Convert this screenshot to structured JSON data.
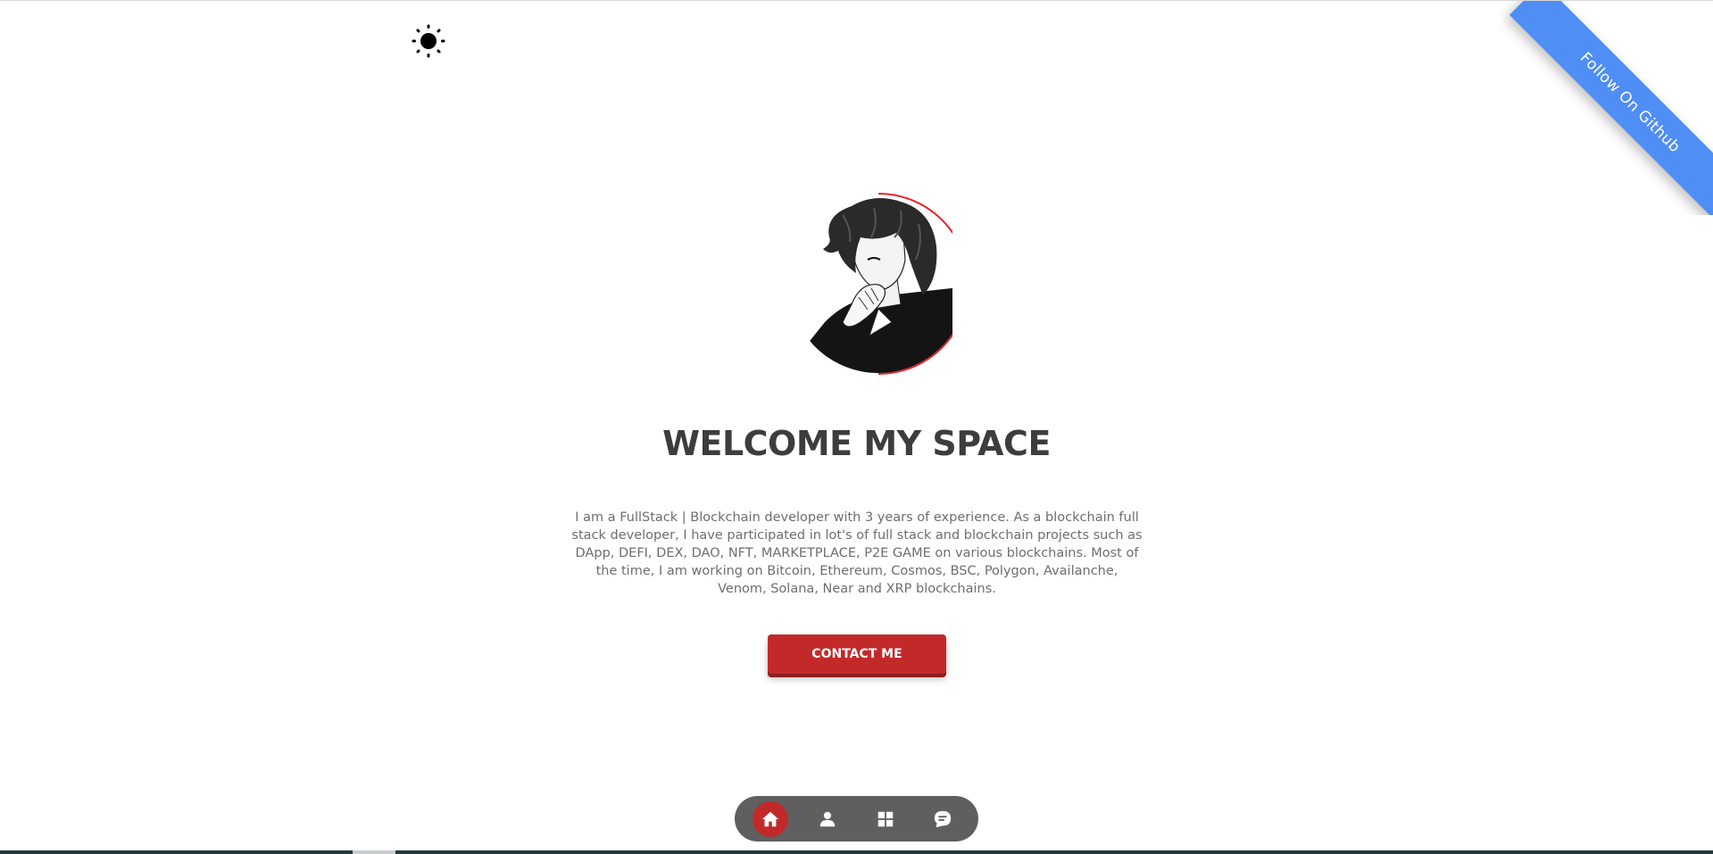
{
  "theme_toggle": {
    "icon": "sun-icon"
  },
  "ribbon": {
    "label": "Follow On Github",
    "color": "#4f8ef5"
  },
  "hero": {
    "avatar_icon": "avatar-illustration",
    "title": "WELCOME MY SPACE",
    "bio": "I am a FullStack | Blockchain developer with 3 years of experience. As a blockchain full stack developer, I have participated in lot's of full stack and blockchain projects such as DApp, DEFI, DEX, DAO, NFT, MARKETPLACE, P2E GAME on various blockchains. Most of the time, I am working on Bitcoin, Ethereum, Cosmos, BSC, Polygon, Availanche, Venom, Solana, Near and XRP blockchains.",
    "contact_label": "CONTACT ME",
    "accent_color": "#c22a2a"
  },
  "bottom_nav": {
    "items": [
      {
        "icon": "home-icon",
        "active": true
      },
      {
        "icon": "user-icon",
        "active": false
      },
      {
        "icon": "grid-icon",
        "active": false
      },
      {
        "icon": "chat-icon",
        "active": false
      }
    ]
  }
}
